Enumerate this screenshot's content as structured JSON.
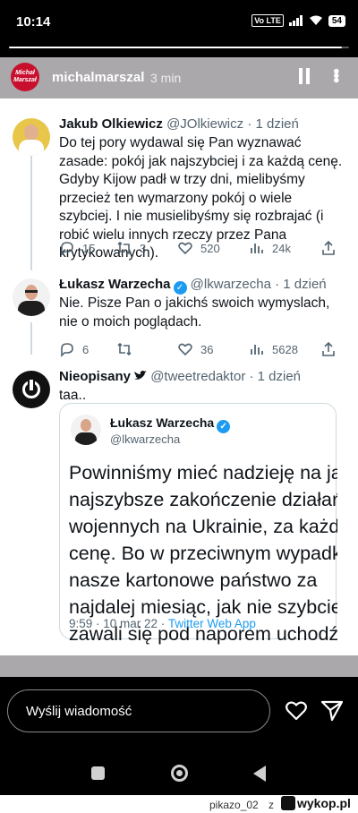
{
  "status_bar": {
    "time": "10:14",
    "network": "Vo LTE",
    "battery": "54"
  },
  "story": {
    "progress": 0.98,
    "avatar_text": "Michał Marszał",
    "username": "michalmarszal",
    "time_ago": "3 min"
  },
  "tweets": [
    {
      "name": "Jakub Olkiewicz",
      "handle": "@JOlkiewicz",
      "time": "· 1 dzień",
      "text": "Do tej pory wydawal się Pan wyznawać zasade: pokój jak najszybciej i za każdą cenę. Gdyby Kijow padł w trzy dni, mielibyśmy przecież ten wymarzony pokój o wiele szybciej. I nie musielibyśmy się rozbrajać (i robić wielu innych rzeczy przez Pana krytykowanych).",
      "replies": "15",
      "retweets": "3",
      "likes": "520",
      "views": "24k"
    },
    {
      "name": "Łukasz Warzecha",
      "handle": "@lkwarzecha",
      "time": "· 1 dzień",
      "text": "Nie. Pisze Pan o jakichś swoich wymyslach, nie o moich poglądach.",
      "replies": "6",
      "retweets": "",
      "likes": "36",
      "views": "5628"
    },
    {
      "name": "Nieopisany",
      "handle": "@tweetredaktor",
      "time": "· 1 dzień",
      "text": "taa.."
    }
  ],
  "quote": {
    "name": "Łukasz Warzecha",
    "handle": "@lkwarzecha",
    "lines": [
      "Powinniśmy mieć nadzieję na jak",
      "najszybsze zakończenie działań",
      "wojennych na Ukrainie, za każdą",
      "cenę. Bo w przeciwnym wypadku",
      "nasze kartonowe państwo za",
      "najdalej miesiąc, jak nie szybciej,",
      "zawali się pod naporem uchodźców"
    ],
    "timestamp": "9:59 · 10 mar 22 · ",
    "app": "Twitter Web App"
  },
  "message_bar": {
    "placeholder": "Wyślij wiadomość"
  },
  "watermark": {
    "user": "pikazo_02",
    "z": "z",
    "logo": "wykop.pl"
  },
  "colors": {
    "accent": "#1d9bf0",
    "muted": "#536471",
    "story_bg": "#aaa8ab",
    "brand_red": "#c8102e"
  }
}
